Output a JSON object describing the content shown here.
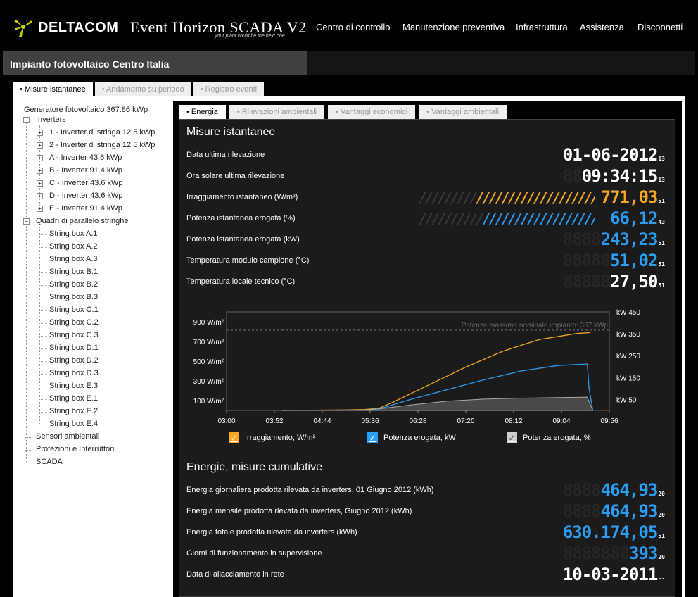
{
  "brand": {
    "logo_text": "DELTACOM",
    "product_name": "Event Horizon SCADA V2",
    "tagline": "your plant could be the next one."
  },
  "nav": [
    {
      "label": "Centro di controllo"
    },
    {
      "label": "Manutenzione preventiva"
    },
    {
      "label": "Infrastruttura"
    },
    {
      "label": "Assistenza"
    },
    {
      "label": "Disconnetti"
    }
  ],
  "page_title": "Impianto fotovoltaico Centro Italia",
  "main_tabs": [
    {
      "label": "• Misure istantanee",
      "active": true
    },
    {
      "label": "• Andamento su periodo",
      "active": false
    },
    {
      "label": "• Registro eventi",
      "active": false
    }
  ],
  "tree": {
    "root": "Generatore fotovoltaico 367.86 kWp",
    "inverters_label": "Inverters",
    "inverters": [
      "1 - Inverter di stringa 12.5 kWp",
      "2 - Inverter di stringa 12.5 kWp",
      "A - Inverter 43.6 kWp",
      "B - Inverter 91.4 kWp",
      "C - Inverter 43.6 kWp",
      "D - Inverter 43.6 kWp",
      "E - Inverter 91.4 kWp"
    ],
    "stringboxes_label": "Quadri di parallelo stringhe",
    "stringboxes": [
      "String box A.1",
      "String box A.2",
      "String box A.3",
      "String box B.1",
      "String box B.2",
      "String box B.3",
      "String box C.1",
      "String box C.2",
      "String box C.3",
      "String box D.1",
      "String box D.2",
      "String box D.3",
      "String box E.3",
      "String box E.1",
      "String box E.2",
      "String box E.4"
    ],
    "others": [
      "Sensori ambientali",
      "Protezioni e Interruttori",
      "SCADA"
    ]
  },
  "sub_tabs": [
    {
      "label": "• Energia",
      "active": true
    },
    {
      "label": "• Rilevazioni ambientali",
      "active": false
    },
    {
      "label": "• Vantaggi economici",
      "active": false
    },
    {
      "label": "• Vantaggi ambientali",
      "active": false
    }
  ],
  "instant": {
    "heading": "Misure istantanee",
    "rows": [
      {
        "label": "Data ultima rilevazione",
        "ghost": "",
        "value": "01-06-2012",
        "suffix": "13",
        "color": "#ffffff"
      },
      {
        "label": "Ora solare ultima rilevazione",
        "ghost": "88",
        "value": "09:34:15",
        "suffix": "13",
        "color": "#ffffff"
      },
      {
        "label": "Irraggiamento istantaneo (W/m²)",
        "ghost": "",
        "value": "771,03",
        "suffix": "51",
        "color": "#f5a623"
      },
      {
        "label": "Potenza istantanea erogata (%)",
        "ghost": "",
        "value": "66,12",
        "suffix": "43",
        "color": "#2a9df4"
      },
      {
        "label": "Potenza istantanea erogata (kW)",
        "ghost": "8888",
        "value": "243,23",
        "suffix": "51",
        "color": "#2a9df4"
      },
      {
        "label": "Temperatura modulo campione (°C)",
        "ghost": "88888",
        "value": "51,02",
        "suffix": "51",
        "color": "#2a9df4"
      },
      {
        "label": "Temperatura locale tecnico (°C)",
        "ghost": "88888",
        "value": "27,50",
        "suffix": "51",
        "color": "#ffffff"
      }
    ],
    "irradiance_bar": {
      "fraction": 0.7,
      "color": "#f5a623"
    },
    "power_bar": {
      "fraction": 0.66,
      "color": "#2a9df4"
    }
  },
  "chart_data": {
    "type": "line",
    "annotation": "Potenza massima nominale impianto: 367 kWp",
    "x_ticks": [
      "03:00",
      "03:52",
      "04:44",
      "05:36",
      "06:28",
      "07:20",
      "08:12",
      "09:04",
      "09:56"
    ],
    "y_left_ticks": [
      "900 W/m²",
      "700 W/m²",
      "500 W/m²",
      "300 W/m²",
      "100 W/m²"
    ],
    "y_right_ticks": [
      "kW 450",
      "kW 350",
      "kW 250",
      "kW 150",
      "kW 50"
    ],
    "xlim_min": [
      180,
      596
    ],
    "y_left_lim": [
      0,
      1000
    ],
    "y_right_lim": [
      0,
      450
    ],
    "reference_kw": 367,
    "series": [
      {
        "name": "Irraggiamento, W/m²",
        "axis": "left",
        "color": "#f5a623",
        "x": [
          240,
          310,
          330,
          345,
          360,
          400,
          440,
          480,
          520,
          560,
          575
        ],
        "y": [
          0,
          5,
          10,
          20,
          80,
          260,
          440,
          600,
          720,
          780,
          790
        ]
      },
      {
        "name": "Potenza erogata, kW",
        "axis": "right",
        "color": "#2a9df4",
        "x": [
          300,
          335,
          350,
          380,
          420,
          460,
          500,
          540,
          572,
          574,
          578
        ],
        "y": [
          0,
          2,
          12,
          50,
          95,
          140,
          180,
          205,
          212,
          100,
          0
        ]
      },
      {
        "name": "Potenza erogata, %",
        "axis": "left",
        "color": "#cccccc",
        "x": [
          240,
          330,
          345,
          380,
          420,
          460,
          500,
          540,
          572,
          578
        ],
        "y": [
          0,
          5,
          15,
          55,
          95,
          115,
          125,
          130,
          135,
          0
        ]
      }
    ]
  },
  "legend": [
    {
      "label": "Irraggiamento, W/m²",
      "color": "#f5a623"
    },
    {
      "label": "Potenza erogata, kW",
      "color": "#2a9df4"
    },
    {
      "label": "Potenza erogata, %",
      "color": "#cccccc"
    }
  ],
  "cumulative": {
    "heading": "Energie, misure cumulative",
    "rows": [
      {
        "label": "Energia giornaliera prodotta rilevata da inverters, 01 Giugno 2012 (kWh)",
        "ghost": "8888",
        "value": "464,93",
        "suffix": "20",
        "color": "#2a9df4"
      },
      {
        "label": "Energia mensile prodotta rlevata da inverters, Giugno 2012 (kWh)",
        "ghost": "8888",
        "value": "464,93",
        "suffix": "20",
        "color": "#2a9df4"
      },
      {
        "label": "Energia totale prodotta rilevata da inverters (kWh)",
        "ghost": "",
        "value": "630.174,05",
        "suffix": "51",
        "color": "#2a9df4"
      },
      {
        "label": "Giorni di funzionamento in supervisione",
        "ghost": "8888888",
        "value": "393",
        "suffix": "20",
        "color": "#2a9df4"
      },
      {
        "label": "Data di allacciamento in rete",
        "ghost": "",
        "value": "10-03-2011",
        "suffix": "--",
        "color": "#ffffff"
      }
    ]
  }
}
